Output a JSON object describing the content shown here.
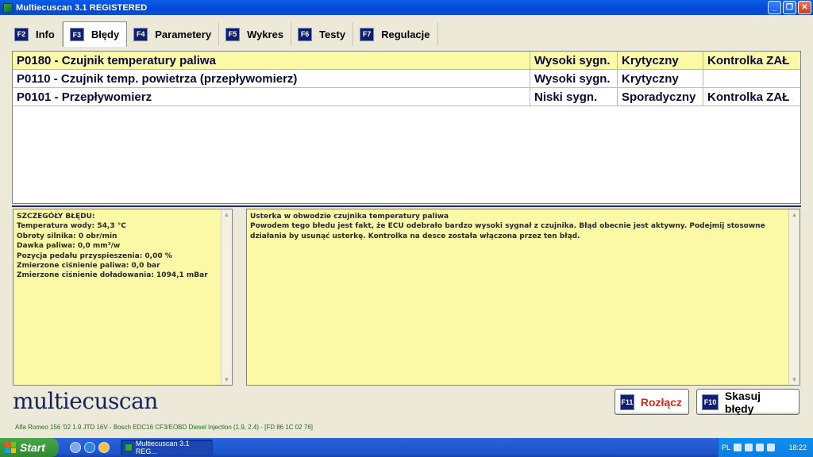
{
  "window": {
    "title": "Multiecuscan 3.1 REGISTERED"
  },
  "tabs": [
    {
      "key": "F2",
      "label": "Info"
    },
    {
      "key": "F3",
      "label": "Błędy"
    },
    {
      "key": "F4",
      "label": "Parametery"
    },
    {
      "key": "F5",
      "label": "Wykres"
    },
    {
      "key": "F6",
      "label": "Testy"
    },
    {
      "key": "F7",
      "label": "Regulacje"
    }
  ],
  "faults": [
    {
      "code": "P0180 - Czujnik temperatury paliwa",
      "signal": "Wysoki sygn.",
      "severity": "Krytyczny",
      "lamp": "Kontrolka ZAŁ"
    },
    {
      "code": "P0110 - Czujnik temp. powietrza (przepływomierz)",
      "signal": "Wysoki sygn.",
      "severity": "Krytyczny",
      "lamp": ""
    },
    {
      "code": "P0101 - Przepływomierz",
      "signal": "Niski sygn.",
      "severity": "Sporadyczny",
      "lamp": "Kontrolka ZAŁ"
    }
  ],
  "details": {
    "heading": "SZCZEGÓŁY BŁĘDU:",
    "lines": [
      "Temperatura wody: 54,3 °C",
      "Obroty silnika: 0 obr/min",
      "Dawka paliwa: 0,0 mm³/w",
      "Pozycja pedału przyspieszenia: 0,00 %",
      "Zmierzone ciśnienie paliwa: 0,0 bar",
      "Zmierzone ciśnienie doładowania: 1094,1 mBar"
    ]
  },
  "description": {
    "title": "Usterka w obwodzie czujnika temperatury paliwa",
    "text": "Powodem tego błedu jest fakt, że ECU odebrało bardzo wysoki sygnał z czujnika. Błąd obecnie jest aktywny. Podejmij stosowne działania by usunąć usterkę. Kontrolka na desce została włączona przez ten błąd."
  },
  "logo": "multiecuscan",
  "buttons": {
    "disconnect": {
      "key": "F11",
      "label": "Rozłącz"
    },
    "clear": {
      "key": "F10",
      "label": "Skasuj błędy"
    }
  },
  "status": "Alfa Romeo 156 '02 1.9 JTD 16V - Bosch EDC16 CF3/EOBD Diesel Injection (1.9, 2.4) - [FD 86 1C 02 76]",
  "taskbar": {
    "start_label": "Start",
    "task_label": "Multiecuscan 3.1 REG...",
    "lang": "PL",
    "clock": "18:22"
  }
}
